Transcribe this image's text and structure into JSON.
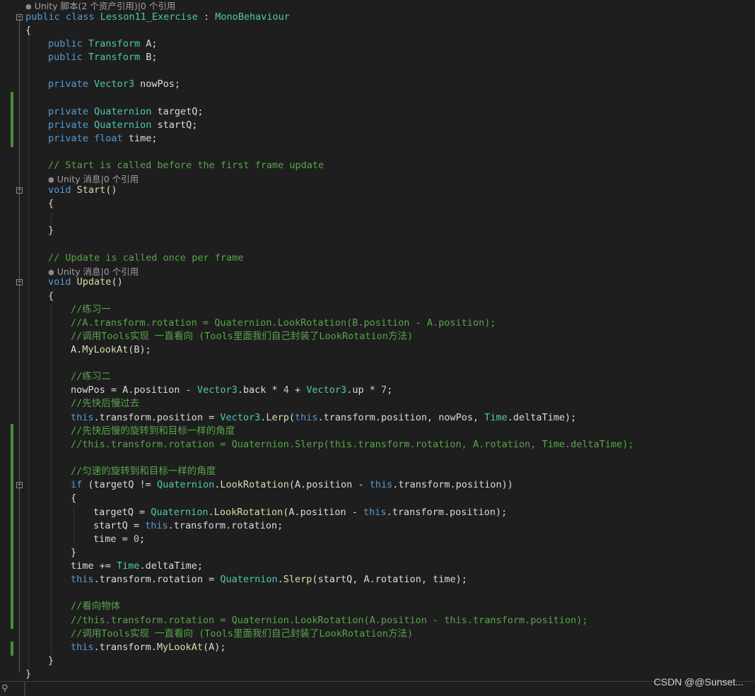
{
  "code_lens": {
    "class_refs": "Unity 脚本(2 个资产引用)|0 个引用",
    "start_refs": "Unity 消息|0 个引用",
    "update_refs": "Unity 消息|0 个引用"
  },
  "code": {
    "class_decl": {
      "kw": "public class",
      "name": "Lesson11_Exercise",
      "sep": " : ",
      "base": "MonoBehaviour"
    },
    "brace_open": "{",
    "brace_close": "}",
    "field_a": {
      "kw": "public",
      "type": "Transform",
      "rest": " A;"
    },
    "field_b": {
      "kw": "public",
      "type": "Transform",
      "rest": " B;"
    },
    "field_nowpos": {
      "kw": "private",
      "type": "Vector3",
      "rest": " nowPos;"
    },
    "field_targetq": {
      "kw": "private",
      "type": "Quaternion",
      "rest": " targetQ;"
    },
    "field_startq": {
      "kw": "private",
      "type": "Quaternion",
      "rest": " startQ;"
    },
    "field_time": {
      "kw": "private",
      "type": "float",
      "rest": " time;"
    },
    "comment_start": "// Start is called before the first frame update",
    "start_decl": {
      "kw": "void",
      "name": "Start",
      "rest": "()"
    },
    "comment_update": "// Update is called once per frame",
    "update_decl": {
      "kw": "void",
      "name": "Update",
      "rest": "()"
    },
    "c_ex1": "//练习一",
    "c_ex1_alt": "//A.transform.rotation = Quaternion.LookRotation(B.position - A.position);",
    "c_tools1": "//调用Tools实现 一直看向 (Tools里面我们自己封装了LookRotation方法)",
    "stmt_mylookat_a": {
      "obj": "A.",
      "fn": "MyLookAt",
      "rest": "(B);"
    },
    "c_ex2": "//练习二",
    "stmt_nowpos": {
      "a": "nowPos = A.position - ",
      "t1": "Vector3",
      "b": ".back * ",
      "n1": "4",
      "c": " + ",
      "t2": "Vector3",
      "d": ".up * ",
      "n2": "7",
      "e": ";"
    },
    "c_fast_slow": "//先快后慢过去",
    "stmt_lerp": {
      "kw1": "this",
      "a": ".transform.position = ",
      "t1": "Vector3",
      "b": ".",
      "fn": "Lerp",
      "c": "(",
      "kw2": "this",
      "d": ".transform.position, nowPos, ",
      "t2": "Time",
      "e": ".deltaTime);"
    },
    "c_fast_slow_rot": "//先快后慢的旋转到和目标一样的角度",
    "c_slerp_alt": "//this.transform.rotation = Quaternion.Slerp(this.transform.rotation, A.rotation, Time.deltaTime);",
    "c_uniform": "//匀速的旋转到和目标一样的角度",
    "stmt_if": {
      "kw": "if",
      "a": " (targetQ != ",
      "t1": "Quaternion",
      "b": ".",
      "fn": "LookRotation",
      "c": "(A.position - ",
      "kw2": "this",
      "d": ".transform.position))"
    },
    "stmt_targetq": {
      "a": "targetQ = ",
      "t1": "Quaternion",
      "b": ".",
      "fn": "LookRotation",
      "c": "(A.position - ",
      "kw2": "this",
      "d": ".transform.position);"
    },
    "stmt_startq": {
      "a": "startQ = ",
      "kw": "this",
      "b": ".transform.rotation;"
    },
    "stmt_time_zero": {
      "a": "time = ",
      "n": "0",
      "b": ";"
    },
    "stmt_time_add": {
      "a": "time += ",
      "t": "Time",
      "b": ".deltaTime;"
    },
    "stmt_slerp": {
      "kw": "this",
      "a": ".transform.rotation = ",
      "t": "Quaternion",
      "b": ".",
      "fn": "Slerp",
      "c": "(startQ, A.rotation, time);"
    },
    "c_look": "//看向物体",
    "c_look_alt": "//this.transform.rotation = Quaternion.LookRotation(A.position - this.transform.position);",
    "c_tools2": "//调用Tools实现 一直看向 (Tools里面我们自己封装了LookRotation方法)",
    "stmt_mylookat_this": {
      "kw": "this",
      "a": ".transform.",
      "fn": "MyLookAt",
      "b": "(A);"
    }
  },
  "watermark": "CSDN @@Sunset...",
  "colors": {
    "background": "#1e1e1e",
    "keyword": "#569cd6",
    "type": "#4ec9b0",
    "method": "#dcdcaa",
    "comment": "#57a64a",
    "number": "#b5cea8",
    "text": "#dcdcdc",
    "change_marker": "#4b8b3b"
  }
}
